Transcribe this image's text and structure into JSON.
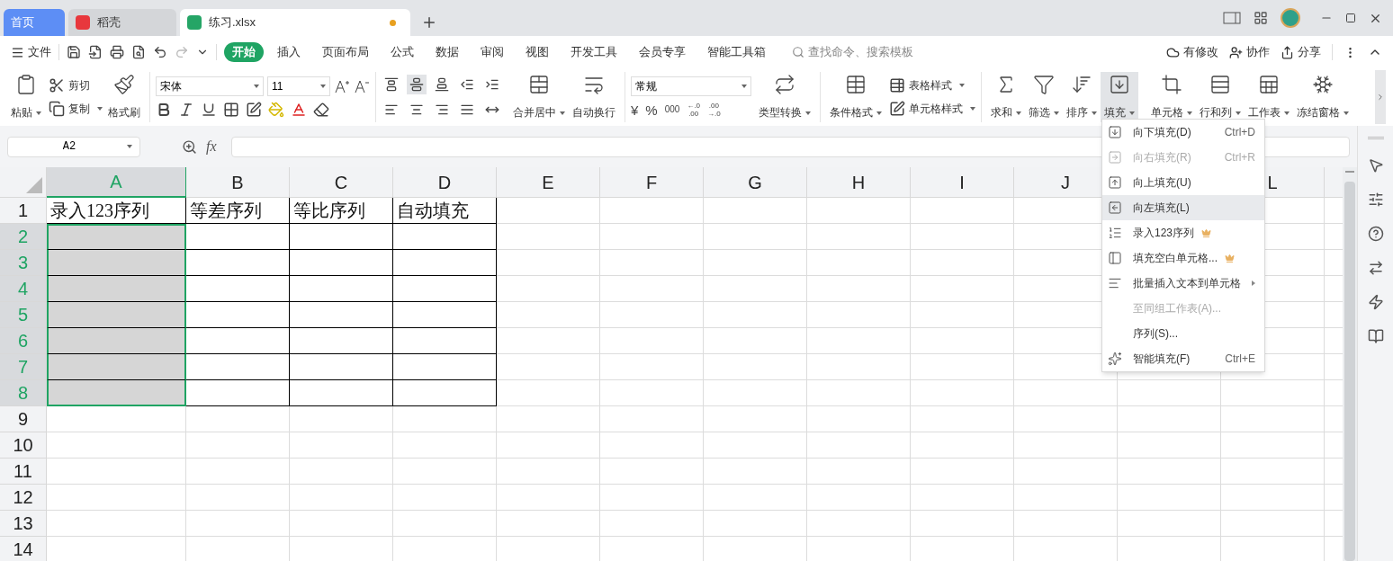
{
  "tabs": [
    {
      "label": "首页",
      "kind": "home",
      "selected": false
    },
    {
      "label": "稻壳",
      "kind": "docer",
      "selected": false
    },
    {
      "label": "练习.xlsx",
      "kind": "sheet",
      "selected": true,
      "modified": true
    }
  ],
  "menu": {
    "file": "文件",
    "tabs": [
      {
        "label": "开始",
        "selected": true
      },
      {
        "label": "插入",
        "selected": false
      },
      {
        "label": "页面布局",
        "selected": false
      },
      {
        "label": "公式",
        "selected": false
      },
      {
        "label": "数据",
        "selected": false
      },
      {
        "label": "审阅",
        "selected": false
      },
      {
        "label": "视图",
        "selected": false
      },
      {
        "label": "开发工具",
        "selected": false
      },
      {
        "label": "会员专享",
        "selected": false
      },
      {
        "label": "智能工具箱",
        "selected": false
      }
    ],
    "search": {
      "placeholder": "查找命令、搜索模板"
    },
    "actions": [
      {
        "label": "有修改",
        "kind": "cloud"
      },
      {
        "label": "协作",
        "kind": "user"
      },
      {
        "label": "分享",
        "kind": "share"
      }
    ]
  },
  "ribbon": {
    "paste": "粘贴",
    "cut": "剪切",
    "copy": "复制",
    "format_painter": "格式刷",
    "font_name": "宋体",
    "font_size": "11",
    "align_buttons": [
      {
        "kind": "top",
        "selected": false
      },
      {
        "kind": "middle",
        "selected": true
      },
      {
        "kind": "bottom",
        "selected": false
      },
      {
        "kind": "outdent",
        "selected": false
      },
      {
        "kind": "indent",
        "selected": false
      },
      {
        "kind": "left",
        "selected": false
      },
      {
        "kind": "center",
        "selected": false
      },
      {
        "kind": "right",
        "selected": false
      },
      {
        "kind": "justify",
        "selected": false
      },
      {
        "kind": "distribute",
        "selected": false
      }
    ],
    "merge": "合并居中",
    "wrap": "自动换行",
    "number_format": "常规",
    "currency": "¥",
    "percent": "%",
    "thousands": "000",
    "increase_decimal": [
      "←.0",
      ".00"
    ],
    "decrease_decimal": [
      ".00",
      "→.0"
    ],
    "convert": "类型转换",
    "conditional_format": "条件格式",
    "table_style": "表格样式",
    "cell_style": "单元格样式",
    "tools": [
      {
        "label": "求和",
        "kind": "sum",
        "expanded": false
      },
      {
        "label": "筛选",
        "kind": "filter",
        "expanded": false
      },
      {
        "label": "排序",
        "kind": "sort",
        "expanded": false
      },
      {
        "label": "填充",
        "kind": "fill",
        "expanded": true,
        "menu": [
          {
            "label": "向下填充(D)",
            "shortcut": "Ctrl+D",
            "kind": "down",
            "disabled": false,
            "selected": false
          },
          {
            "label": "向右填充(R)",
            "shortcut": "Ctrl+R",
            "kind": "right",
            "disabled": true,
            "selected": false
          },
          {
            "label": "向上填充(U)",
            "kind": "up",
            "disabled": false,
            "selected": false
          },
          {
            "label": "向左填充(L)",
            "kind": "left",
            "disabled": false,
            "selected": true
          },
          {
            "label": "录入123序列",
            "kind": "sequence",
            "disabled": false,
            "selected": false,
            "premium": true
          },
          {
            "label": "填充空白单元格...",
            "kind": "blank",
            "disabled": false,
            "selected": false,
            "premium": true
          },
          {
            "label": "批量插入文本到单元格",
            "kind": "text",
            "disabled": false,
            "selected": false,
            "submenu": true
          },
          {
            "label": "至同组工作表(A)...",
            "kind": "none",
            "disabled": true,
            "selected": false
          },
          {
            "label": "序列(S)...",
            "kind": "none",
            "disabled": false,
            "selected": false
          },
          {
            "label": "智能填充(F)",
            "shortcut": "Ctrl+E",
            "kind": "smart",
            "disabled": false,
            "selected": false
          }
        ]
      },
      {
        "label": "单元格",
        "kind": "cell",
        "expanded": false
      },
      {
        "label": "行和列",
        "kind": "rowcol",
        "expanded": false
      },
      {
        "label": "工作表",
        "kind": "worksheet",
        "expanded": false
      },
      {
        "label": "冻结窗格",
        "kind": "freeze",
        "expanded": false
      }
    ]
  },
  "sheet": {
    "name_box": "A2",
    "fx": "fx",
    "columns": [
      {
        "label": "A",
        "selected": true
      },
      {
        "label": "B",
        "selected": false
      },
      {
        "label": "C",
        "selected": false
      },
      {
        "label": "D",
        "selected": false
      },
      {
        "label": "E",
        "selected": false
      },
      {
        "label": "F",
        "selected": false
      },
      {
        "label": "G",
        "selected": false
      },
      {
        "label": "H",
        "selected": false
      },
      {
        "label": "I",
        "selected": false
      },
      {
        "label": "J",
        "selected": false
      },
      {},
      {
        "label": "L",
        "selected": false
      }
    ],
    "rows": [
      {
        "label": "1",
        "selected": false,
        "bordered": true,
        "cells": [
          "录入123序列",
          "等差序列",
          "等比序列",
          "自动填充"
        ]
      },
      {
        "label": "2",
        "selected": true,
        "bordered": true
      },
      {
        "label": "3",
        "selected": true,
        "bordered": true
      },
      {
        "label": "4",
        "selected": true,
        "bordered": true
      },
      {
        "label": "5",
        "selected": true,
        "bordered": true
      },
      {
        "label": "6",
        "selected": true,
        "bordered": true
      },
      {
        "label": "7",
        "selected": true,
        "bordered": true
      },
      {
        "label": "8",
        "selected": true,
        "bordered": true
      },
      {
        "label": "9",
        "selected": false,
        "bordered": false
      },
      {
        "label": "10",
        "selected": false,
        "bordered": false
      },
      {
        "label": "11",
        "selected": false,
        "bordered": false
      },
      {
        "label": "12",
        "selected": false,
        "bordered": false
      },
      {
        "label": "13",
        "selected": false,
        "bordered": false
      },
      {
        "label": "14",
        "selected": false,
        "bordered": false
      }
    ]
  }
}
